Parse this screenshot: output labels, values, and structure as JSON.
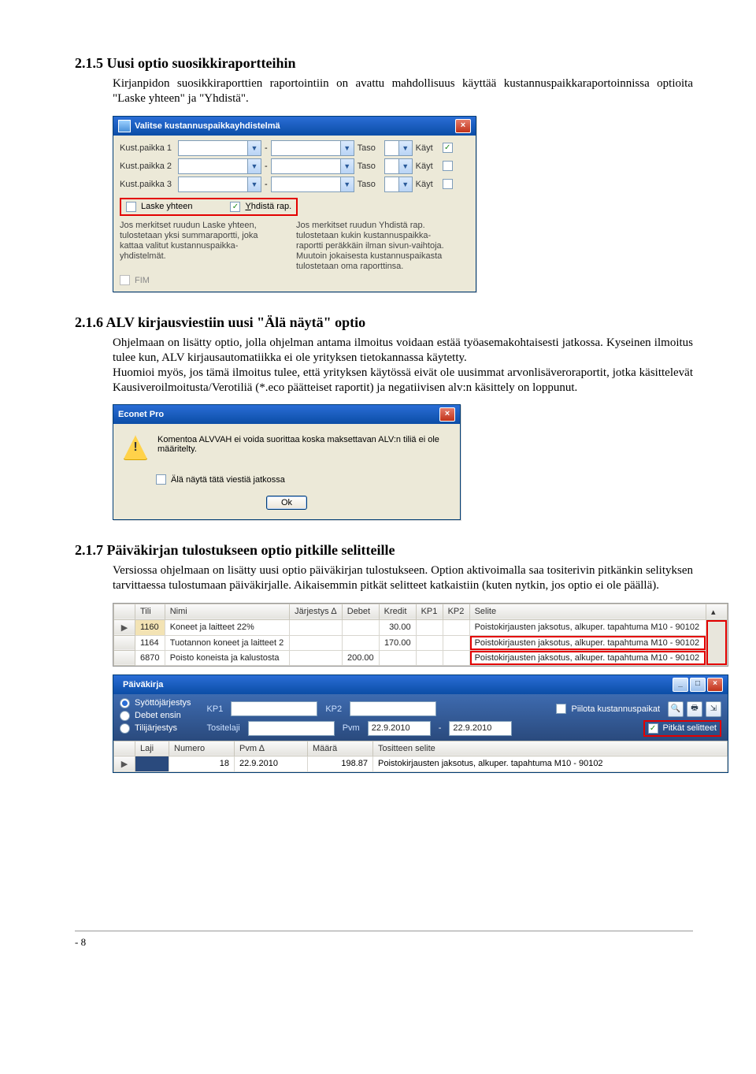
{
  "s215": {
    "heading": "2.1.5  Uusi optio suosikkiraportteihin",
    "p1": "Kirjanpidon suosikkiraporttien raportointiin on avattu mahdollisuus käyttää kustannuspaikkaraportoinnissa optioita \"Laske yhteen\" ja \"Yhdistä\"."
  },
  "dialog1": {
    "title": "Valitse kustannuspaikkayhdistelmä",
    "rows": [
      {
        "label": "Kust.paikka 1",
        "taso": "Taso",
        "kayt": "Käyt",
        "checked": true
      },
      {
        "label": "Kust.paikka 2",
        "taso": "Taso",
        "kayt": "Käyt",
        "checked": false
      },
      {
        "label": "Kust.paikka 3",
        "taso": "Taso",
        "kayt": "Käyt",
        "checked": false
      }
    ],
    "laske": "Laske yhteen",
    "yhdista": "Yhdistä rap.",
    "leftHelp": "Jos merkitset ruudun Laske yhteen, tulostetaan yksi summaraportti, joka kattaa valitut kustannuspaikka-yhdistelmät.",
    "rightHelp": "Jos merkitset ruudun Yhdistä rap. tulostetaan kukin kustannuspaikka-raportti peräkkäin ilman sivun-vaihtoja. Muutoin jokaisesta kustannuspaikasta tulostetaan oma raporttinsa.",
    "fim": "FIM"
  },
  "s216": {
    "heading": "2.1.6  ALV kirjausviestiin uusi \"Älä näytä\" optio",
    "p1": "Ohjelmaan on lisätty optio, jolla ohjelman antama ilmoitus voidaan estää työasemakohtaisesti jatkossa. Kyseinen ilmoitus tulee kun, ALV kirjausautomatiikka ei ole yrityksen tietokannassa käytetty.",
    "p2": "Huomioi myös, jos tämä ilmoitus tulee, että yrityksen käytössä eivät ole uusimmat arvonlisäveroraportit, jotka käsittelevät Kausiveroilmoitusta/Verotiliä (*.eco päätteiset raportit) ja negatiivisen alv:n käsittely on loppunut."
  },
  "econet": {
    "title": "Econet Pro",
    "msg": "Komentoa ALVVAH ei voida suorittaa koska maksettavan ALV:n tiliä ei ole määritelty.",
    "chkLabel": "Älä näytä tätä viestiä jatkossa",
    "ok": "Ok"
  },
  "s217": {
    "heading": "2.1.7  Päiväkirjan tulostukseen optio pitkille selitteille",
    "p1": "Versiossa ohjelmaan on lisätty uusi optio päiväkirjan tulostukseen. Option aktivoimalla saa tositerivin pitkänkin selityksen tarvittaessa tulostumaan päiväkirjalle. Aikaisemmin pitkät selitteet katkaistiin (kuten nytkin, jos optio ei ole päällä)."
  },
  "grid": {
    "headers": [
      "Tili",
      "Nimi",
      "Järjestys ∆",
      "Debet",
      "Kredit",
      "KP1",
      "KP2",
      "Selite"
    ],
    "rows": [
      {
        "tili": "1160",
        "nimi": "Koneet ja laitteet 22%",
        "jarj": "",
        "debet": "",
        "kredit": "30.00",
        "kp1": "",
        "kp2": "",
        "selite": "Poistokirjausten jaksotus, alkuper. tapahtuma  M10 - 90102"
      },
      {
        "tili": "1164",
        "nimi": "Tuotannon koneet ja laitteet 2",
        "jarj": "",
        "debet": "",
        "kredit": "170.00",
        "kp1": "",
        "kp2": "",
        "selite": "Poistokirjausten jaksotus, alkuper. tapahtuma  M10 - 90102"
      },
      {
        "tili": "6870",
        "nimi": "Poisto koneista ja kalustosta",
        "jarj": "",
        "debet": "200.00",
        "kredit": "",
        "kp1": "",
        "kp2": "",
        "selite": "Poistokirjausten jaksotus, alkuper. tapahtuma  M10 - 90102"
      }
    ]
  },
  "pk": {
    "title": "Päiväkirja",
    "opts": [
      "Syöttöjärjestys",
      "Debet ensin",
      "Tilijärjestys"
    ],
    "kp1": "KP1",
    "kp2": "KP2",
    "tositelaji": "Tositelaji",
    "pvm": "Pvm",
    "pvmVal": "22.9.2010",
    "pvmTo": "22.9.2010",
    "piilota": "Piilota kustannuspaikat",
    "pitkat": "Pitkät selitteet",
    "headers": [
      "Laji",
      "Numero",
      "Pvm ∆",
      "Määrä",
      "Tositteen selite"
    ],
    "row": {
      "laji": "",
      "numero": "18",
      "pvm": "22.9.2010",
      "maara": "198.87",
      "selite": "Poistokirjausten jaksotus, alkuper. tapahtuma  M10 - 90102"
    }
  },
  "pageNumber": "- 8"
}
